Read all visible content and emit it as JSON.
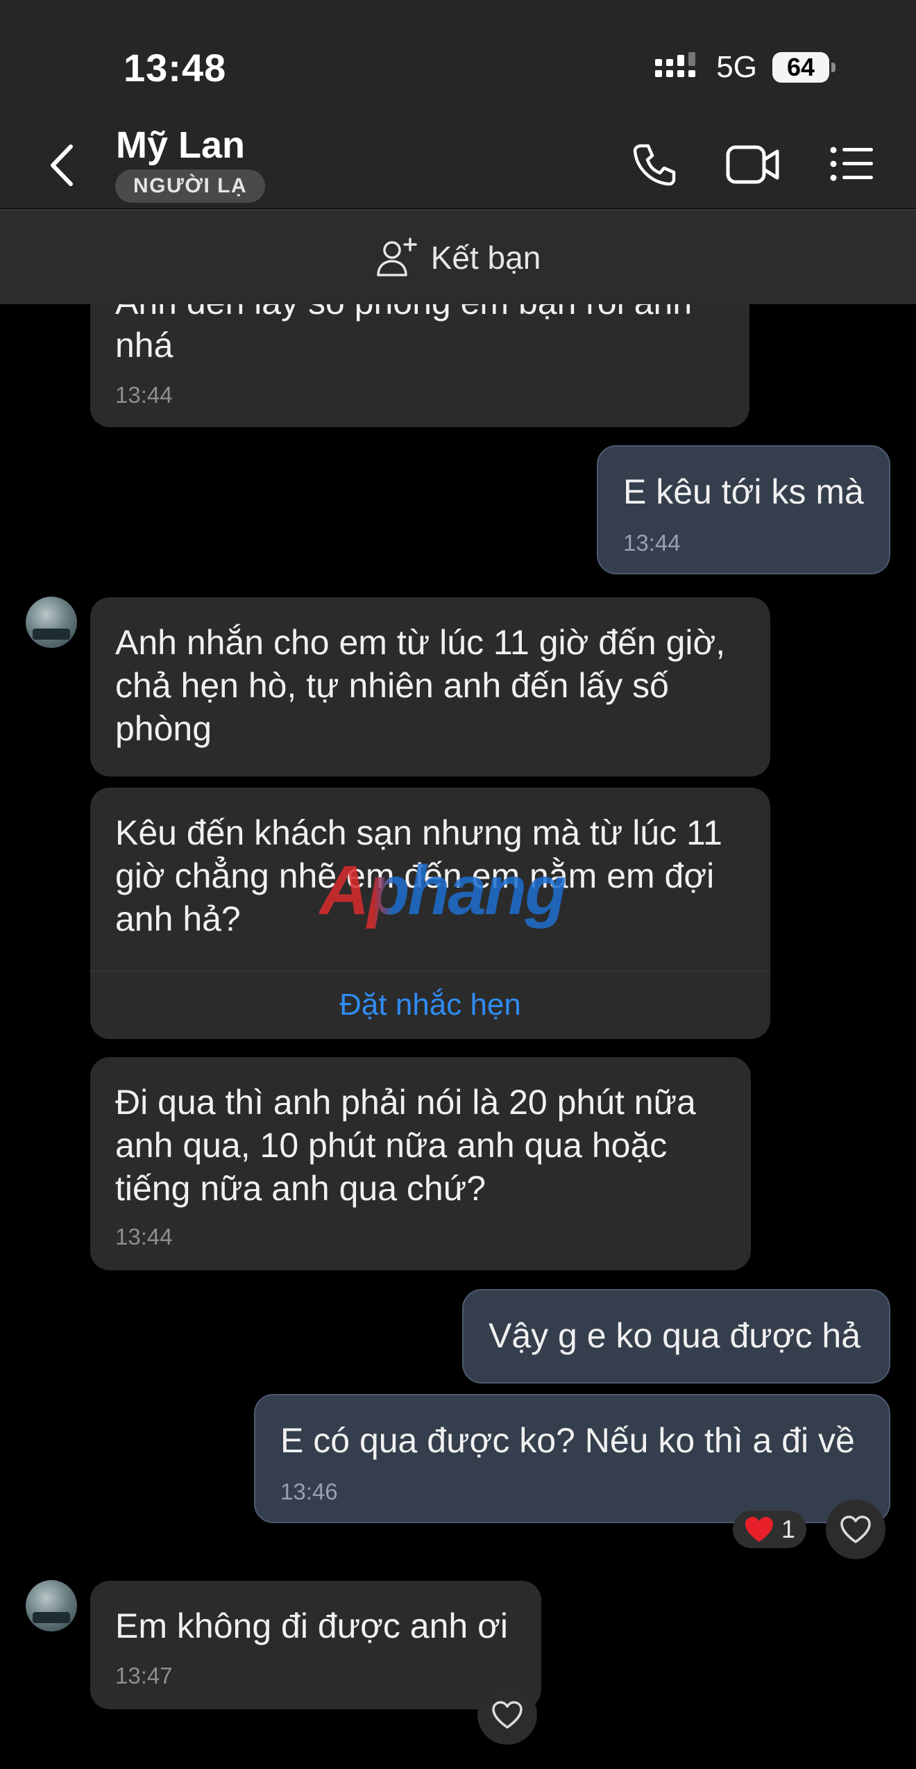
{
  "status_bar": {
    "time": "13:48",
    "network": "5G",
    "battery": "64"
  },
  "header": {
    "contact_name": "Mỹ Lan",
    "badge": "NGƯỜI LẠ"
  },
  "friend_bar": {
    "label": "Kết bạn"
  },
  "messages": [
    {
      "text": "Anh đến lấy số phòng em bạn rồi anh\nnhá",
      "time": "13:44"
    },
    {
      "text": "E kêu tới ks mà",
      "time": "13:44"
    },
    {
      "text": "Anh nhắn cho em từ lúc 11 giờ đến giờ,\nchả hẹn hò, tự nhiên anh đến lấy số\nphòng"
    },
    {
      "text": "Kêu đến khách sạn nhưng mà từ lúc 11\ngiờ chẳng nhẽ em đến em nằm em đợi\nanh hả?",
      "action": "Đặt nhắc hẹn"
    },
    {
      "text": "Đi qua thì anh phải nói là 20 phút nữa\nanh qua, 10 phút nữa anh qua hoặc\ntiếng nữa anh qua chứ?",
      "time": "13:44"
    },
    {
      "text": "Vậy g e ko qua được hả"
    },
    {
      "text": "E có qua được ko? Nếu ko thì a đi về",
      "time": "13:46",
      "reaction_count": "1"
    },
    {
      "text": "Em không đi được anh ơi",
      "time": "13:47"
    }
  ],
  "watermark": "Aphang",
  "colors": {
    "accent_link": "#2f8cf0",
    "outgoing_bubble": "#353e4d",
    "incoming_bubble": "#2b2b2b",
    "heart": "#e8202a"
  }
}
